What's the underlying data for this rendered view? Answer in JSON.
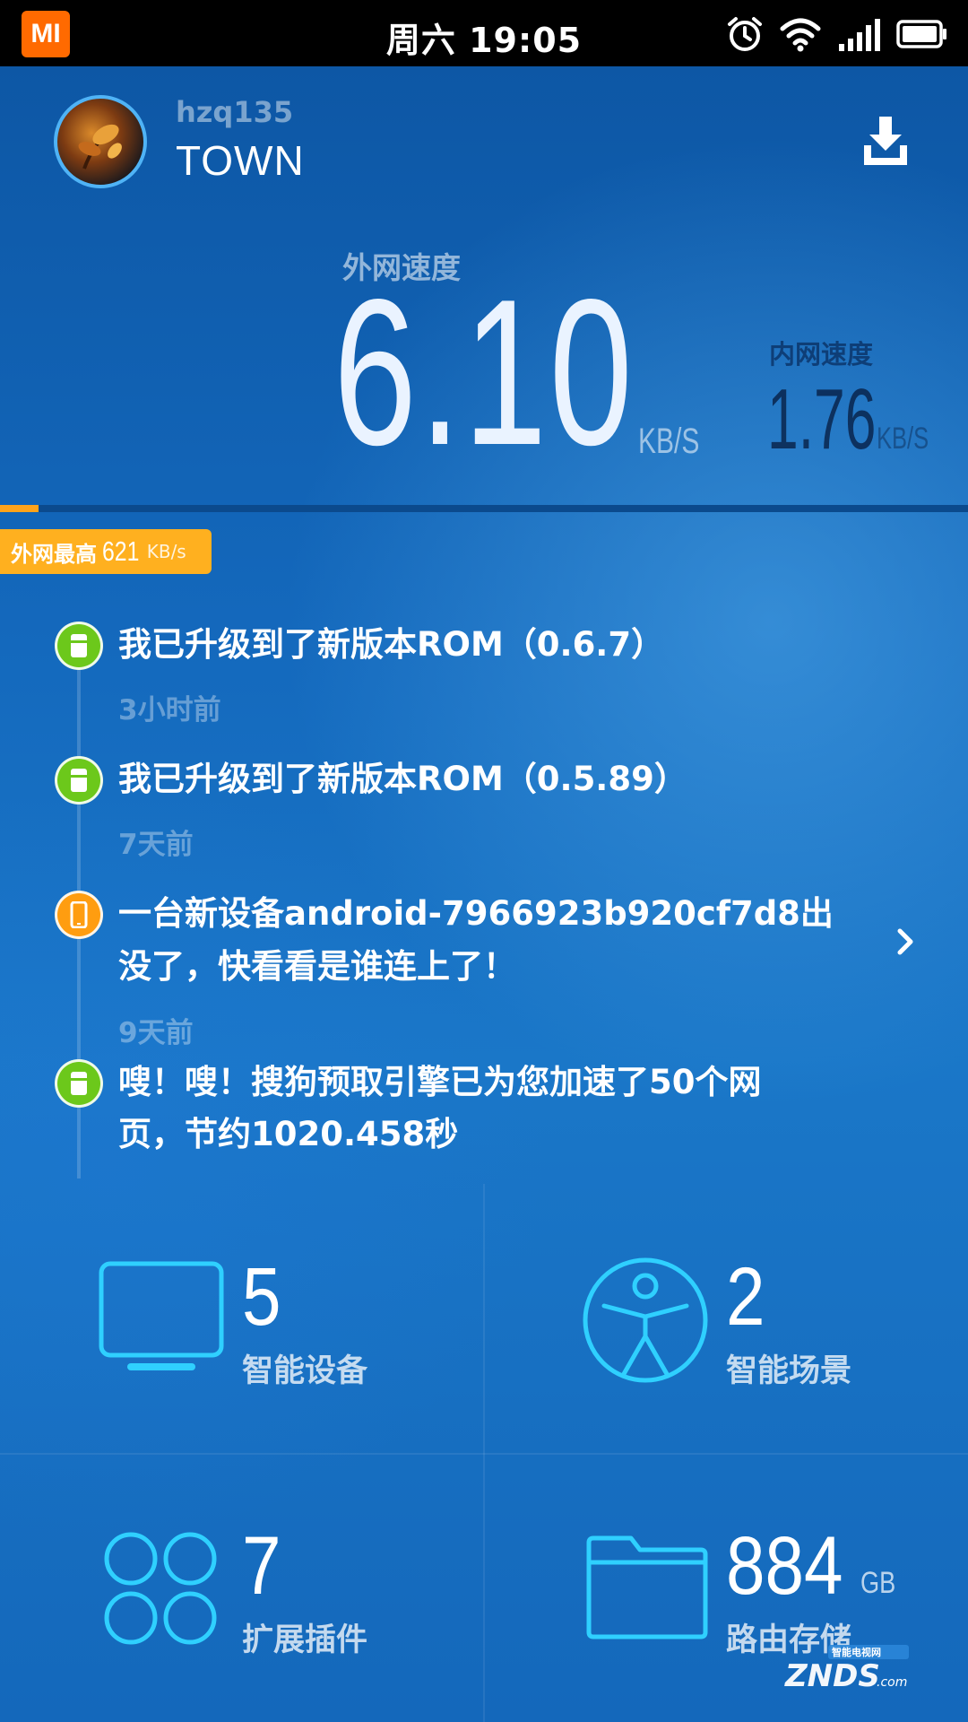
{
  "status_bar": {
    "logo": "MI",
    "time": "周六 19:05",
    "icons": [
      "alarm-icon",
      "wifi-icon",
      "signal-icon",
      "battery-icon"
    ]
  },
  "header": {
    "username": "hzq135",
    "router_name": "TOWN",
    "download_icon": "download-icon"
  },
  "speed": {
    "wan_label": "外网速度",
    "wan_value": "6.10",
    "wan_unit": "KB/S",
    "lan_label": "内网速度",
    "lan_value": "1.76",
    "lan_unit": "KB/S",
    "progress_fraction": 0.04
  },
  "max_badge": {
    "label": "外网最高",
    "value": "621",
    "unit": "KB/s"
  },
  "timeline": [
    {
      "icon": "router-icon",
      "color": "#6cc81b",
      "text": "我已升级到了新版本ROM（0.6.7）",
      "time": "3小时前"
    },
    {
      "icon": "router-icon",
      "color": "#6cc81b",
      "text": "我已升级到了新版本ROM（0.5.89）",
      "time": "7天前"
    },
    {
      "icon": "phone-icon",
      "color": "#ff9d10",
      "text_line1": "一台新设备android-7966923b920cf7d8出",
      "text_line2": "没了，快看看是谁连上了！",
      "time": "9天前"
    },
    {
      "icon": "router-icon",
      "color": "#6cc81b",
      "text_line1": "嗖！嗖！搜狗预取引擎已为您加速了50个网",
      "text_line2": "页，节约1020.458秒"
    }
  ],
  "tiles": [
    {
      "icon": "tv-icon",
      "value": "5",
      "label": "智能设备"
    },
    {
      "icon": "person-icon",
      "value": "2",
      "label": "智能场景"
    },
    {
      "icon": "plugins-icon",
      "value": "7",
      "label": "扩展插件"
    },
    {
      "icon": "folder-icon",
      "value": "884",
      "unit": "GB",
      "label": "路由存储"
    }
  ],
  "colors": {
    "accent_orange": "#ffb01f",
    "green": "#6cc81b",
    "icon_cyan": "#2fd0ff",
    "background": "#1469bd"
  }
}
